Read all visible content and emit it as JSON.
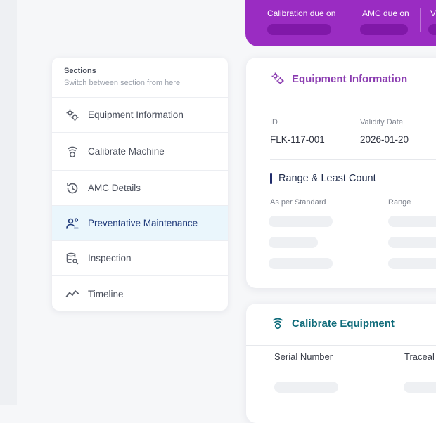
{
  "banner": {
    "stats": [
      {
        "label": "Calibration due on"
      },
      {
        "label": "AMC due on"
      },
      {
        "label": "V"
      }
    ]
  },
  "sections": {
    "title": "Sections",
    "subtitle": "Switch between section from here",
    "items": [
      {
        "label": "Equipment Information",
        "icon": "gears-icon",
        "active": false
      },
      {
        "label": "Calibrate Machine",
        "icon": "calibrate-icon",
        "active": false
      },
      {
        "label": "AMC Details",
        "icon": "history-icon",
        "active": false
      },
      {
        "label": "Preventative Maintenance",
        "icon": "user-gear-icon",
        "active": true
      },
      {
        "label": "Inspection",
        "icon": "inspection-icon",
        "active": false
      },
      {
        "label": "Timeline",
        "icon": "timeline-icon",
        "active": false
      }
    ]
  },
  "equipment": {
    "title": "Equipment Information",
    "id_label": "ID",
    "id_value": "FLK-117-001",
    "validity_label": "Validity Date",
    "validity_value": "2026-01-20",
    "range_title": "Range & Least Count",
    "col_standard": "As per Standard",
    "col_range": "Range"
  },
  "calibrate": {
    "title": "Calibrate Equipment",
    "col_serial": "Serial Number",
    "col_trace": "Traceal"
  },
  "colors": {
    "banner": "#9a2cc2",
    "equipment_title": "#8a3bb0",
    "calibrate_title": "#0f6b7a",
    "range_accent": "#1f2b6b",
    "active_bg": "#eaf6fc"
  }
}
